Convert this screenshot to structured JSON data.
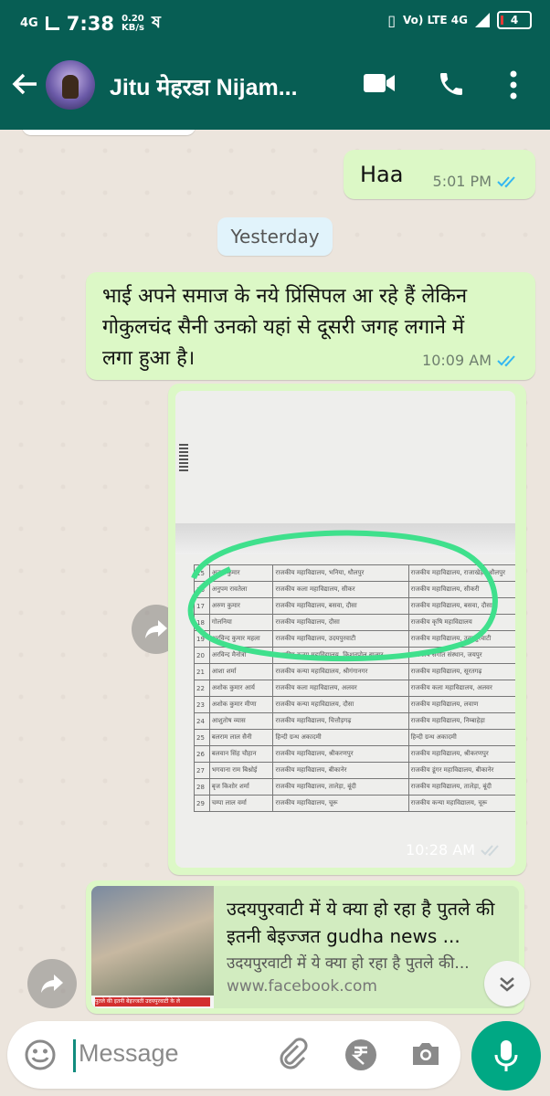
{
  "status_bar": {
    "network": "4G",
    "time": "7:38",
    "speed_value": "0.20",
    "speed_unit": "KB/s",
    "right_network": "Vo) LTE 4G",
    "battery": "4"
  },
  "header": {
    "contact_name": "Jitu मेहरडा Nijam..."
  },
  "messages": [
    {
      "text": "Haa",
      "time": "5:01 PM"
    },
    {
      "text": "भाई अपने समाज के नये प्रिंसिपल आ रहे हैं लेकिन गोकुलचंद सैनी उनको यहां से दूसरी जगह लगाने में लगा हुआ है।",
      "time": "10:09 AM"
    },
    {
      "time": "10:28 AM"
    }
  ],
  "date_separator": "Yesterday",
  "document_rows": [
    [
      "15",
      "अनुज कुमार",
      "राजकीय महाविद्यालय, भनिया, धौलपुर",
      "राजकीय महाविद्यालय, राजाखेड़ा, धौलपुर"
    ],
    [
      "16",
      "अनुपम रावतेला",
      "राजकीय कला महाविद्यालय, सीकर",
      "राजकीय महाविद्यालय, सीकरी"
    ],
    [
      "17",
      "अरुण कुमार",
      "राजकीय महाविद्यालय, बसवा, दौसा",
      "राजकीय महाविद्यालय, बसवा, दौसा"
    ],
    [
      "18",
      "गोलनिया",
      "राजकीय महाविद्यालय, दौसा",
      "राजकीय कृषि महाविद्यालय"
    ],
    [
      "19",
      "अरविन्द कुमार महला",
      "राजकीय महाविद्यालय, उदयपुरवाटी",
      "राजकीय महाविद्यालय, उदयपुरवाटी"
    ],
    [
      "20",
      "अरविन्द मैनोत्रा",
      "राजकीय कन्या महाविद्यालय, किशनपोल बाजार",
      "राजकीय संगीत संस्थान, जयपुर"
    ],
    [
      "21",
      "आशा शर्मा",
      "राजकीय कन्या महाविद्यालय, श्रीगंगानगर",
      "राजकीय महाविद्यालय, सूरतगढ़"
    ],
    [
      "22",
      "अशोक कुमार आर्य",
      "राजकीय कला महाविद्यालय, अलवर",
      "राजकीय कला महाविद्यालय, अलवर"
    ],
    [
      "23",
      "अशोक कुमार मीणा",
      "राजकीय कन्या महाविद्यालय, दौसा",
      "राजकीय महाविद्यालय, लवाण"
    ],
    [
      "24",
      "आशुतोष व्यास",
      "राजकीय महाविद्यालय, चित्तौड़गढ़",
      "राजकीय महाविद्यालय, निम्बाहेड़ा"
    ],
    [
      "25",
      "बलराम लाल सैनी",
      "हिन्दी ग्रन्थ अकादमी",
      "हिन्दी ग्रन्थ अकादमी"
    ],
    [
      "26",
      "बलवान सिंह चौहान",
      "राजकीय महाविद्यालय, श्रीकरणपुर",
      "राजकीय महाविद्यालय, श्रीकरणपुर"
    ],
    [
      "27",
      "भगवाना राम बिश्नोई",
      "राजकीय महाविद्यालय, बीकानेर",
      "राजकीय डूंगर महाविद्यालय, बीकानेर"
    ],
    [
      "28",
      "बृज किशोर शर्मा",
      "राजकीय महाविद्यालय, तालेड़ा, बूंदी",
      "राजकीय महाविद्यालय, तालेड़ा, बूंदी"
    ],
    [
      "29",
      "चम्पा लाल वर्मा",
      "राजकीय महाविद्यालय, चूरू",
      "राजकीय कन्या महाविद्यालय, चूरू"
    ]
  ],
  "link_preview": {
    "title": "उदयपुरवाटी में ये क्या हो रहा है पुतले की इतनी बेइज्जत gudha news ...",
    "description": "उदयपुरवाटी में ये क्या हो रहा है पुतले की...",
    "url": "www.facebook.com",
    "thumb_caption": "पुतले की इतनी बेइज्जती उदयपुरवाटी के ले"
  },
  "composer": {
    "placeholder": "Message"
  },
  "colors": {
    "header": "#075e54",
    "outgoing_bubble": "#dcf8c6",
    "ticks": "#34b7f1",
    "mic": "#00a884",
    "highlight_circle": "#3fe08c"
  }
}
